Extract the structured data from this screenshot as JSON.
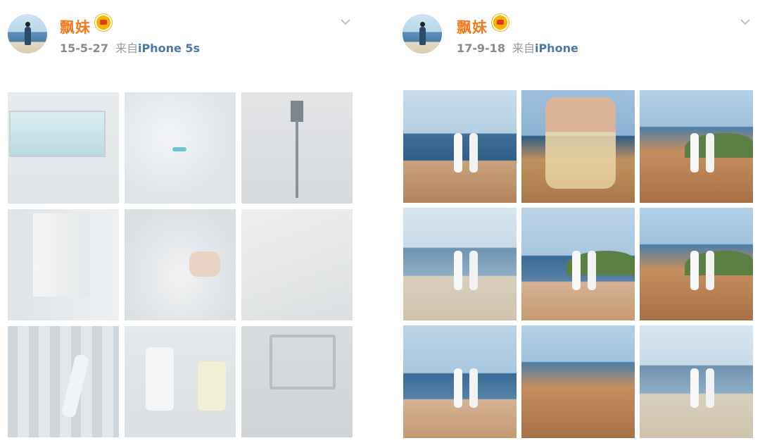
{
  "posts": [
    {
      "username": "飘妹",
      "date": "15-5-27",
      "source_prefix": "来自",
      "device": "iPhone 5s",
      "photos": [
        "l1",
        "l2",
        "l3",
        "l4",
        "l5",
        "l6",
        "l7",
        "l8",
        "l9"
      ]
    },
    {
      "username": "飘妹",
      "date": "17-9-18",
      "source_prefix": "来自",
      "device": "iPhone",
      "photos": [
        "sea p",
        "hand",
        "rock hill p",
        "sea3 p",
        "sea2 hill p",
        "rock hill p",
        "sea2 p",
        "rock",
        "sea3 p"
      ]
    }
  ],
  "icons": {
    "verified": "vip-crown-badge-icon",
    "menu": "chevron-down-icon"
  }
}
